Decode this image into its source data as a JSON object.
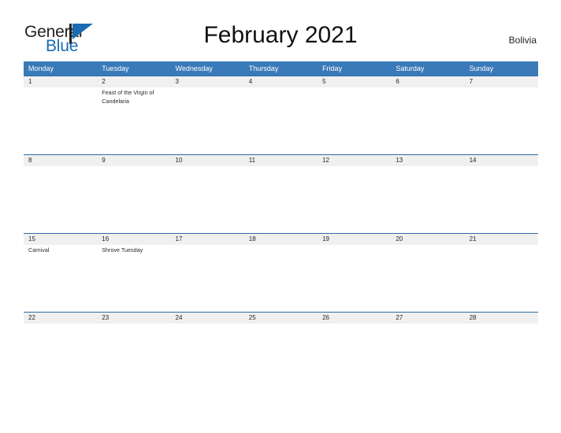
{
  "logo": {
    "text_primary": "General",
    "text_secondary": "Blue",
    "icon": "flag-triangle-icon",
    "color_primary": "#231f20",
    "color_secondary": "#1b6cb0"
  },
  "header": {
    "title": "February 2021",
    "country": "Bolivia",
    "accent_color": "#3a7ab8",
    "row_divider_color": "#2e6da4",
    "day_band_color": "#f0f0f0"
  },
  "weekdays": [
    "Monday",
    "Tuesday",
    "Wednesday",
    "Thursday",
    "Friday",
    "Saturday",
    "Sunday"
  ],
  "weeks": [
    {
      "days": [
        {
          "number": "1",
          "events": ""
        },
        {
          "number": "2",
          "events": "Feast of the Virgin of Candelaria"
        },
        {
          "number": "3",
          "events": ""
        },
        {
          "number": "4",
          "events": ""
        },
        {
          "number": "5",
          "events": ""
        },
        {
          "number": "6",
          "events": ""
        },
        {
          "number": "7",
          "events": ""
        }
      ]
    },
    {
      "days": [
        {
          "number": "8",
          "events": ""
        },
        {
          "number": "9",
          "events": ""
        },
        {
          "number": "10",
          "events": ""
        },
        {
          "number": "11",
          "events": ""
        },
        {
          "number": "12",
          "events": ""
        },
        {
          "number": "13",
          "events": ""
        },
        {
          "number": "14",
          "events": ""
        }
      ]
    },
    {
      "days": [
        {
          "number": "15",
          "events": "Carnival"
        },
        {
          "number": "16",
          "events": "Shrove Tuesday"
        },
        {
          "number": "17",
          "events": ""
        },
        {
          "number": "18",
          "events": ""
        },
        {
          "number": "19",
          "events": ""
        },
        {
          "number": "20",
          "events": ""
        },
        {
          "number": "21",
          "events": ""
        }
      ]
    },
    {
      "days": [
        {
          "number": "22",
          "events": ""
        },
        {
          "number": "23",
          "events": ""
        },
        {
          "number": "24",
          "events": ""
        },
        {
          "number": "25",
          "events": ""
        },
        {
          "number": "26",
          "events": ""
        },
        {
          "number": "27",
          "events": ""
        },
        {
          "number": "28",
          "events": ""
        }
      ]
    }
  ]
}
